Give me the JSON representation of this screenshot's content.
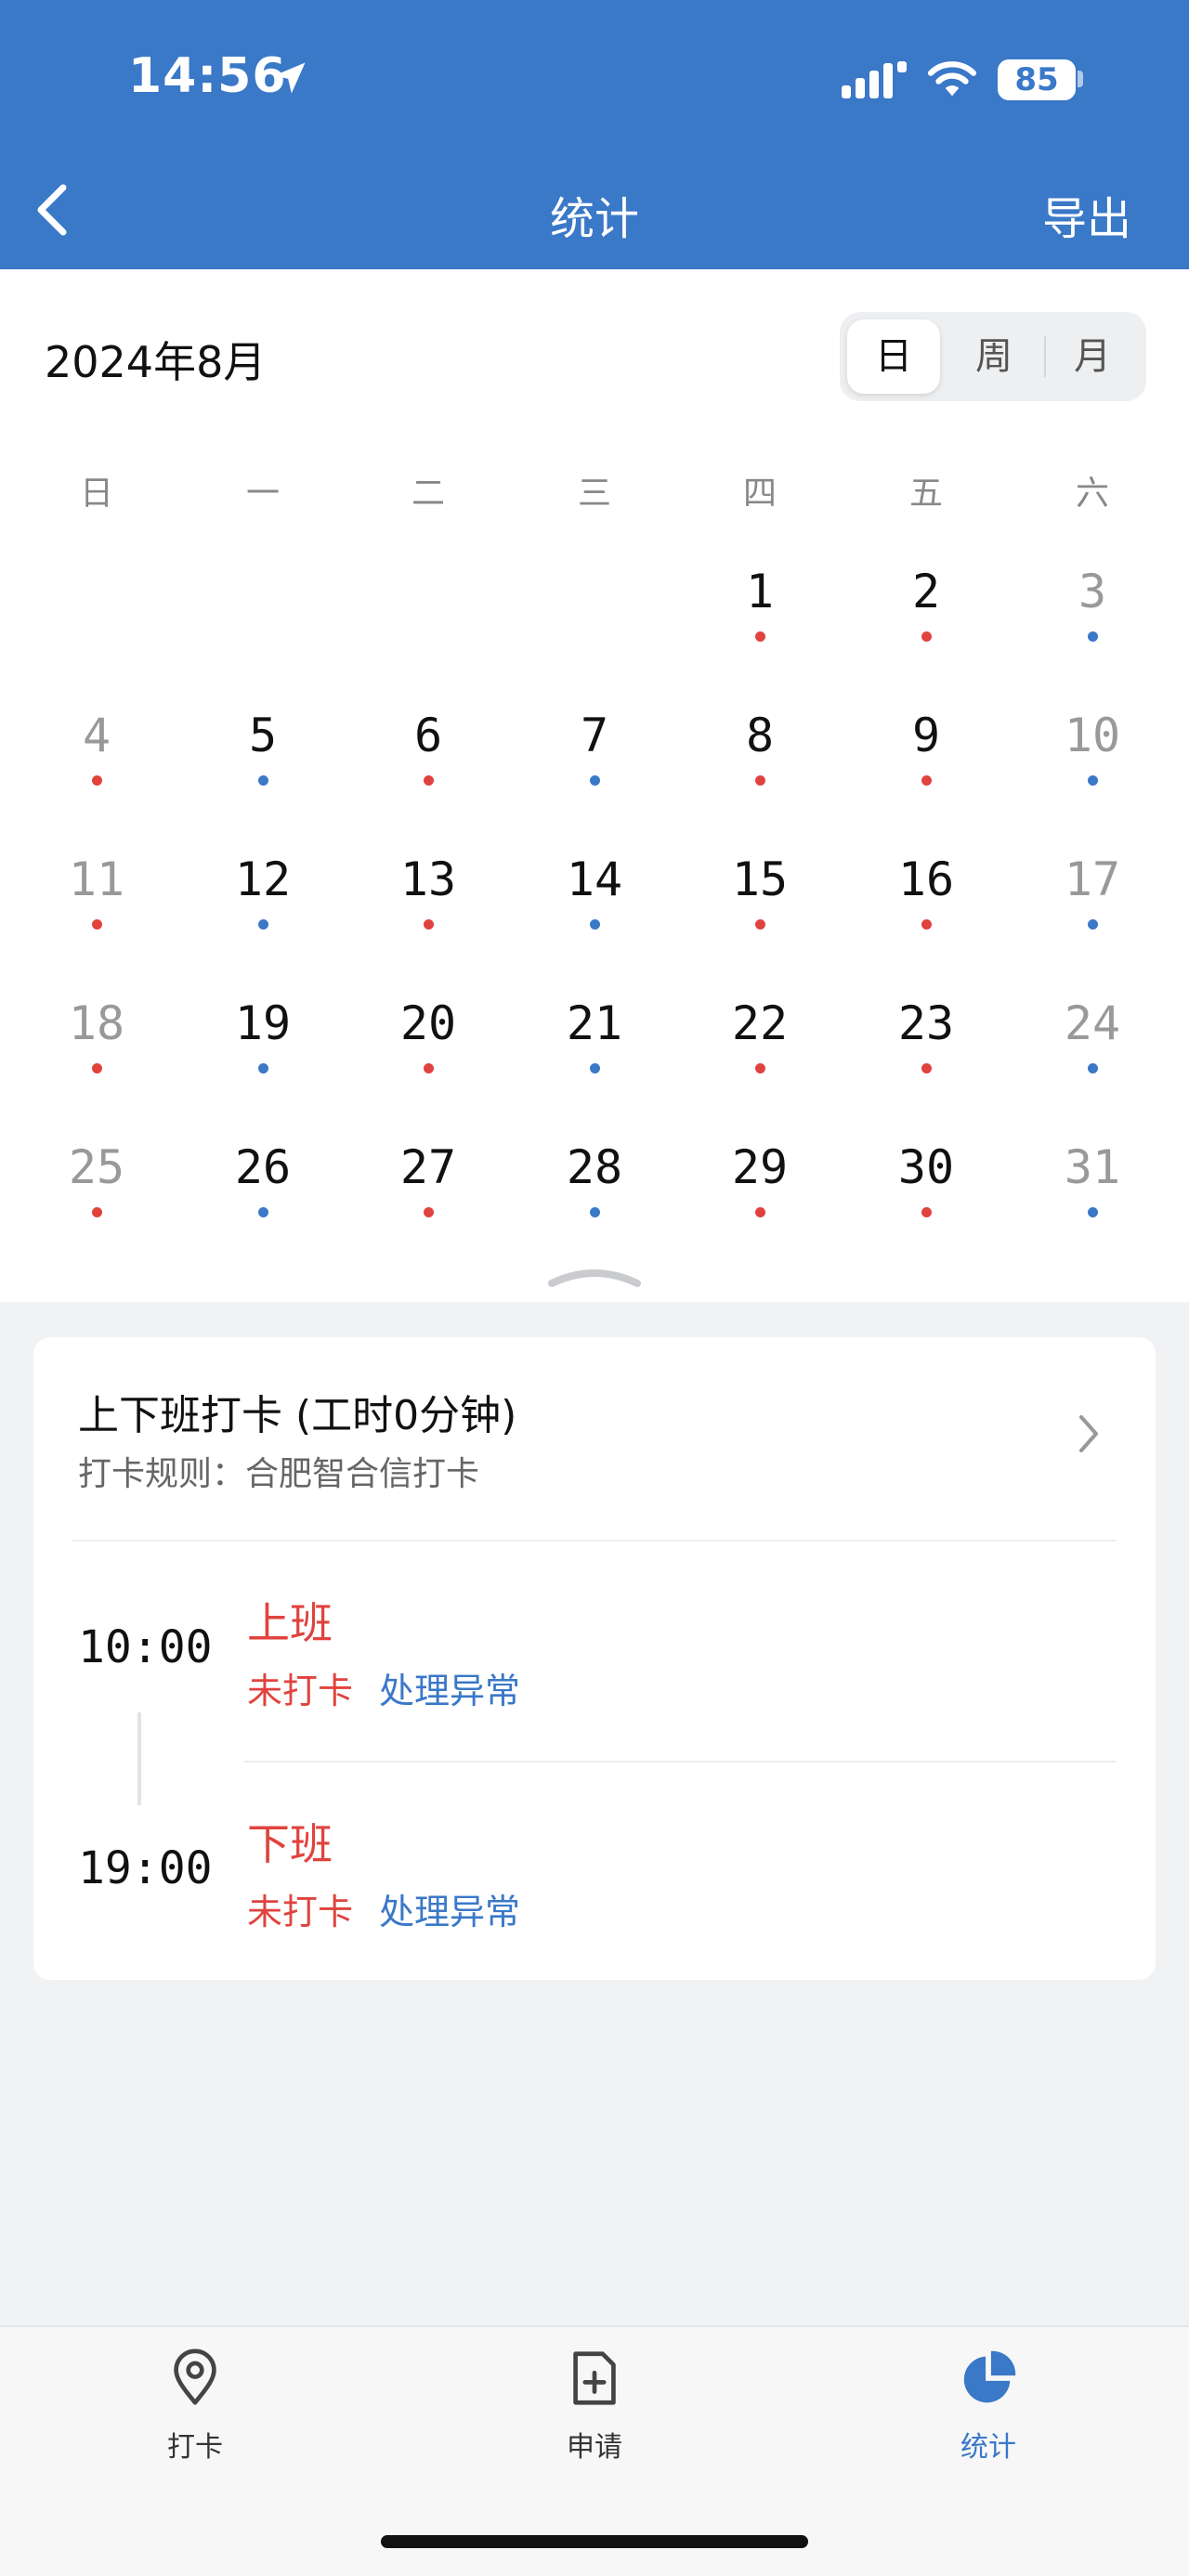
{
  "status_bar": {
    "time": "14:56",
    "battery": "85"
  },
  "nav": {
    "title": "统计",
    "export_label": "导出"
  },
  "calendar": {
    "month_title": "2024年8月",
    "view_modes": [
      "日",
      "周",
      "月"
    ],
    "active_view": "日",
    "weekdays": [
      "日",
      "一",
      "二",
      "三",
      "四",
      "五",
      "六"
    ],
    "first_weekday_index": 4,
    "days": [
      {
        "d": "1",
        "dot": "red"
      },
      {
        "d": "2",
        "dot": "red"
      },
      {
        "d": "3",
        "dot": "blue"
      },
      {
        "d": "4",
        "dot": "red"
      },
      {
        "d": "5",
        "dot": "blue"
      },
      {
        "d": "6",
        "dot": "red"
      },
      {
        "d": "7",
        "dot": "blue"
      },
      {
        "d": "8",
        "dot": "red"
      },
      {
        "d": "9",
        "dot": "red"
      },
      {
        "d": "10",
        "dot": "blue"
      },
      {
        "d": "11",
        "dot": "red"
      },
      {
        "d": "12",
        "dot": "blue"
      },
      {
        "d": "13",
        "dot": "red"
      },
      {
        "d": "14",
        "dot": "blue"
      },
      {
        "d": "15",
        "dot": "red"
      },
      {
        "d": "16",
        "dot": "red"
      },
      {
        "d": "17",
        "dot": "blue"
      },
      {
        "d": "18",
        "dot": "red"
      },
      {
        "d": "19",
        "dot": "blue"
      },
      {
        "d": "20",
        "dot": "red"
      },
      {
        "d": "21",
        "dot": "blue"
      },
      {
        "d": "22",
        "dot": "red"
      },
      {
        "d": "23",
        "dot": "red"
      },
      {
        "d": "24",
        "dot": "blue"
      },
      {
        "d": "25",
        "dot": "red"
      },
      {
        "d": "26",
        "dot": "blue"
      },
      {
        "d": "27",
        "dot": "red"
      },
      {
        "d": "28",
        "dot": "blue"
      },
      {
        "d": "29",
        "dot": "red"
      },
      {
        "d": "30",
        "dot": "red"
      },
      {
        "d": "31",
        "dot": "blue"
      }
    ]
  },
  "attendance": {
    "title": "上下班打卡 (工时0分钟)",
    "rule": "打卡规则：合肥智合信打卡",
    "shifts": [
      {
        "time": "10:00",
        "type": "上班",
        "status": "未打卡",
        "action": "处理异常"
      },
      {
        "time": "19:00",
        "type": "下班",
        "status": "未打卡",
        "action": "处理异常"
      }
    ]
  },
  "tabbar": {
    "items": [
      {
        "label": "打卡",
        "icon": "location-pin-icon"
      },
      {
        "label": "申请",
        "icon": "add-document-icon"
      },
      {
        "label": "统计",
        "icon": "pie-chart-icon"
      }
    ],
    "active": "统计"
  },
  "colors": {
    "primary": "#3a78c8",
    "red_dot": "#e0433e",
    "blue_dot": "#3a78c8"
  }
}
